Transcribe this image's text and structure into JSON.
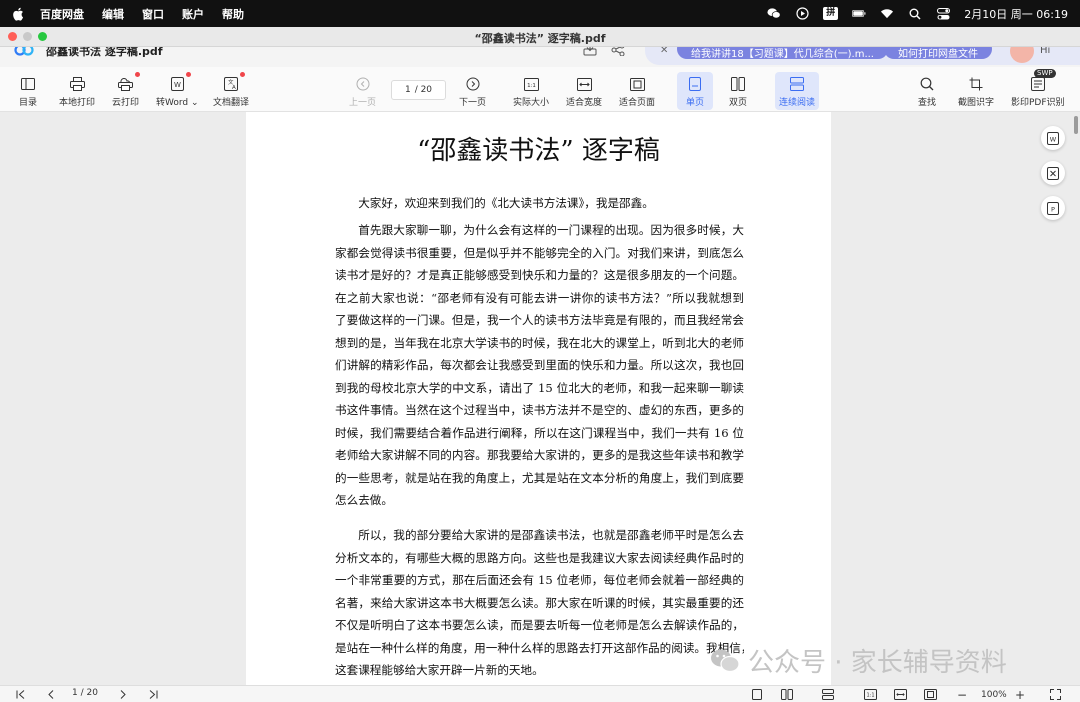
{
  "menubar": {
    "app_name": "百度网盘",
    "items": [
      "编辑",
      "窗口",
      "账户",
      "帮助"
    ],
    "ime": "拼",
    "clock": "2月10日 周一  06:19"
  },
  "window": {
    "title": "“邵鑫读书法” 逐字稿.pdf"
  },
  "tabrow": {
    "doc_title": "邵鑫读书法  逐字稿.pdf",
    "promo_1": "给我讲讲18【习题课】代几综合(一).m...",
    "promo_2": "如何打印网盘文件",
    "greeting": "Hi"
  },
  "toolbar": {
    "toc": "目录",
    "local_print": "本地打印",
    "cloud_print": "云打印",
    "to_word": "转Word",
    "translate": "文档翻译",
    "prev_page": "上一页",
    "page_current": "1",
    "page_sep": "/ 20",
    "next_page": "下一页",
    "actual_size": "实际大小",
    "fit_width": "适合宽度",
    "fit_page": "适合页面",
    "single_page": "单页",
    "double_page": "双页",
    "continuous": "连续阅读",
    "find": "查找",
    "ocr": "截图识字",
    "pdf_ocr": "影印PDF识别",
    "swp_badge": "SWP"
  },
  "document": {
    "title": "“邵鑫读书法” 逐字稿",
    "paragraphs": [
      [
        "大家好，欢迎来到我们的《北大读书方法课》，我是邵鑫。"
      ],
      [
        "首先跟大家聊一聊，为什么会有这样的一门课程的出现。因为很多时候，大",
        "家都会觉得读书很重要，但是似乎并不能够完全的入门。对我们来讲，到底怎么",
        "读书才是好的？才是真正能够感受到快乐和力量的？这是很多朋友的一个问题。",
        "在之前大家也说：“邵老师有没有可能去讲一讲你的读书方法？”所以我就想到",
        "了要做这样的一门课。但是，我一个人的读书方法毕竟是有限的，而且我经常会",
        "想到的是，当年我在北京大学读书的时候，我在北大的课堂上，听到北大的老师",
        "们讲解的精彩作品，每次都会让我感受到里面的快乐和力量。所以这次，我也回",
        "到我的母校北京大学的中文系，请出了 15 位北大的老师，和我一起来聊一聊读",
        "书这件事情。当然在这个过程当中，读书方法并不是空的、虚幻的东西，更多的",
        "时候，我们需要结合着作品进行阐释，所以在这门课程当中，我们一共有 16 位",
        "老师给大家讲解不同的内容。那我要给大家讲的，更多的是我这些年读书和教学",
        "的一些思考，就是站在我的角度上，尤其是站在文本分析的角度上，我们到底要",
        "怎么去做。"
      ],
      [
        "所以，我的部分要给大家讲的是邵鑫读书法，也就是邵鑫老师平时是怎么去",
        "分析文本的，有哪些大概的思路方向。这些也是我建议大家去阅读经典作品时的",
        "一个非常重要的方式，那在后面还会有 15 位老师，每位老师会就着一部经典的",
        "名著，来给大家讲这本书大概要怎么读。那大家在听课的时候，其实最重要的还",
        "不仅是听明白了这本书要怎么读，而是要去听每一位老师是怎么去解读作品的，",
        "是站在一种什么样的角度，用一种什么样的思路去打开这部作品的阅读。我相信，",
        "这套课程能够给大家开辟一片新的天地。"
      ]
    ]
  },
  "watermark": {
    "text": "公众号 · 家长辅导资料"
  },
  "statusbar": {
    "page_current": "1",
    "page_sep": "/ 20",
    "zoom": "100%"
  }
}
